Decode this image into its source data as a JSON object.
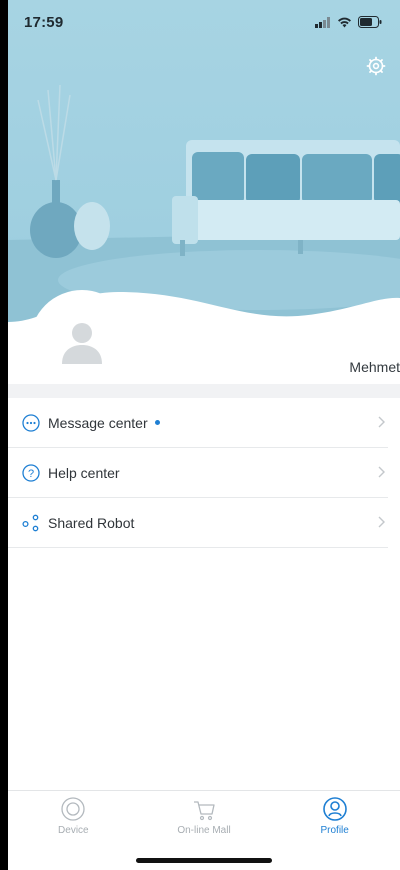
{
  "status_bar": {
    "time": "17:59"
  },
  "profile": {
    "username": "Mehmet"
  },
  "menu": {
    "items": [
      {
        "label": "Message center",
        "icon": "message-icon",
        "has_dot": true
      },
      {
        "label": "Help center",
        "icon": "help-icon",
        "has_dot": false
      },
      {
        "label": "Shared Robot",
        "icon": "share-icon",
        "has_dot": false
      }
    ]
  },
  "tabs": [
    {
      "label": "Device",
      "icon": "device-icon",
      "active": false
    },
    {
      "label": "On-line Mall",
      "icon": "cart-icon",
      "active": false
    },
    {
      "label": "Profile",
      "icon": "profile-icon",
      "active": true
    }
  ],
  "colors": {
    "accent": "#1e7fd3",
    "hero": "#a7d4e3",
    "inactive": "#a7adb2"
  }
}
